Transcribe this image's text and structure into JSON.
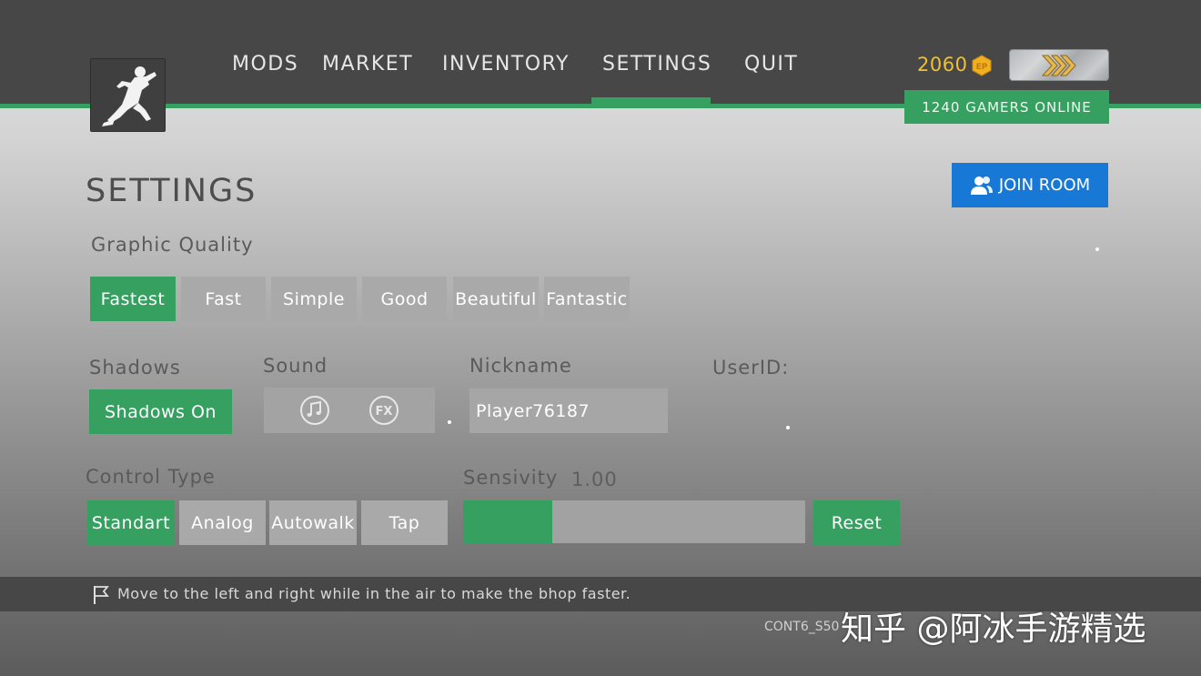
{
  "nav": {
    "items": [
      "MODS",
      "MARKET",
      "INVENTORY",
      "SETTINGS",
      "QUIT"
    ],
    "active": "SETTINGS"
  },
  "currency": {
    "amount": "2060",
    "symbol": "EP",
    "color": "#f0c030"
  },
  "online_status": "1240 GAMERS ONLINE",
  "page_title": "SETTINGS",
  "join_room": {
    "label": "JOIN ROOM",
    "icon": "users-icon"
  },
  "graphic_quality": {
    "label": "Graphic Quality",
    "options": [
      "Fastest",
      "Fast",
      "Simple",
      "Good",
      "Beautiful",
      "Fantastic"
    ],
    "selected": "Fastest"
  },
  "shadows": {
    "label": "Shadows",
    "button": "Shadows On"
  },
  "sound": {
    "label": "Sound",
    "music_icon": "music-note-icon",
    "fx_label": "FX"
  },
  "nickname": {
    "label": "Nickname",
    "value": "Player76187"
  },
  "user_id": {
    "label": "UserID:"
  },
  "control_type": {
    "label": "Control Type",
    "options": [
      "Standart",
      "Analog",
      "Autowalk",
      "Tap"
    ],
    "selected": "Standart"
  },
  "sensitivity": {
    "label": "Sensivity",
    "value": "1.00",
    "fill_fraction": 0.26,
    "reset_label": "Reset"
  },
  "tip": {
    "icon": "flag-icon",
    "text": "Move to the left and right while in the air to make the bhop faster."
  },
  "version_text": "CONT6_S50",
  "watermark": "知乎 @阿冰手游精选",
  "colors": {
    "accent_green": "#36a060",
    "join_blue": "#1878d6",
    "topbar": "#474747"
  }
}
